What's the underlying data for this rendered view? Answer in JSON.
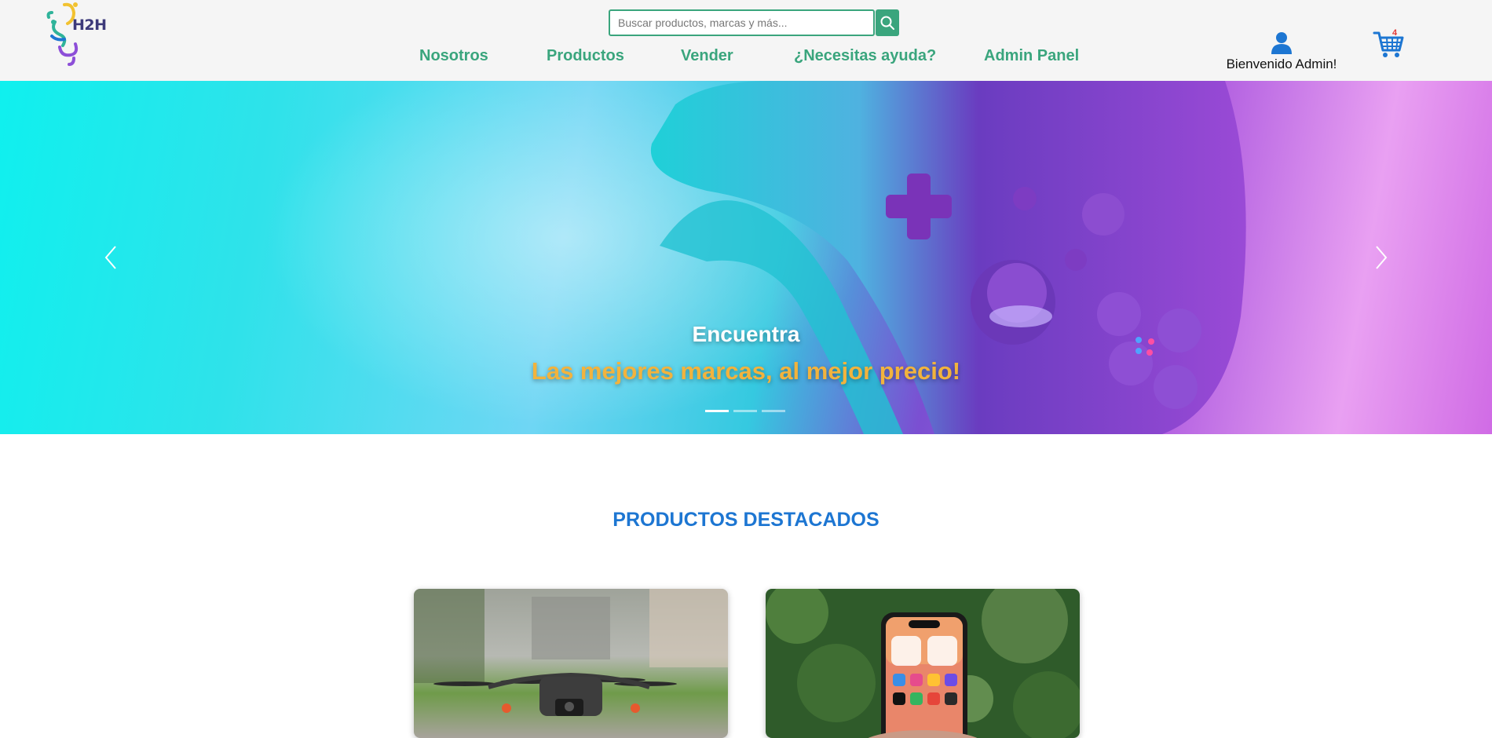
{
  "header": {
    "logo_text": "H2H",
    "search": {
      "placeholder": "Buscar productos, marcas y más...",
      "value": "",
      "button_icon": "search-icon"
    },
    "nav": [
      {
        "label": "Nosotros"
      },
      {
        "label": "Productos"
      },
      {
        "label": "Vender"
      },
      {
        "label": "¿Necesitas ayuda?"
      },
      {
        "label": "Admin Panel"
      }
    ],
    "user": {
      "icon": "user-icon",
      "greeting": "Bienvenido Admin!"
    },
    "cart": {
      "icon": "cart-icon",
      "count": "4"
    }
  },
  "hero": {
    "title": "Encuentra",
    "subtitle": "Las mejores marcas, al mejor precio!",
    "slides_total": 3,
    "active_slide": 1,
    "prev_icon": "chevron-left-icon",
    "next_icon": "chevron-right-icon"
  },
  "featured": {
    "title": "PRODUCTOS DESTACADOS",
    "products": [
      {
        "image": "drone-image"
      },
      {
        "image": "smartphone-image"
      }
    ]
  },
  "colors": {
    "brand_green": "#3aa57d",
    "accent_blue": "#1d76d2",
    "highlight_yellow": "#f2b33d",
    "cart_badge_red": "#e53935"
  }
}
